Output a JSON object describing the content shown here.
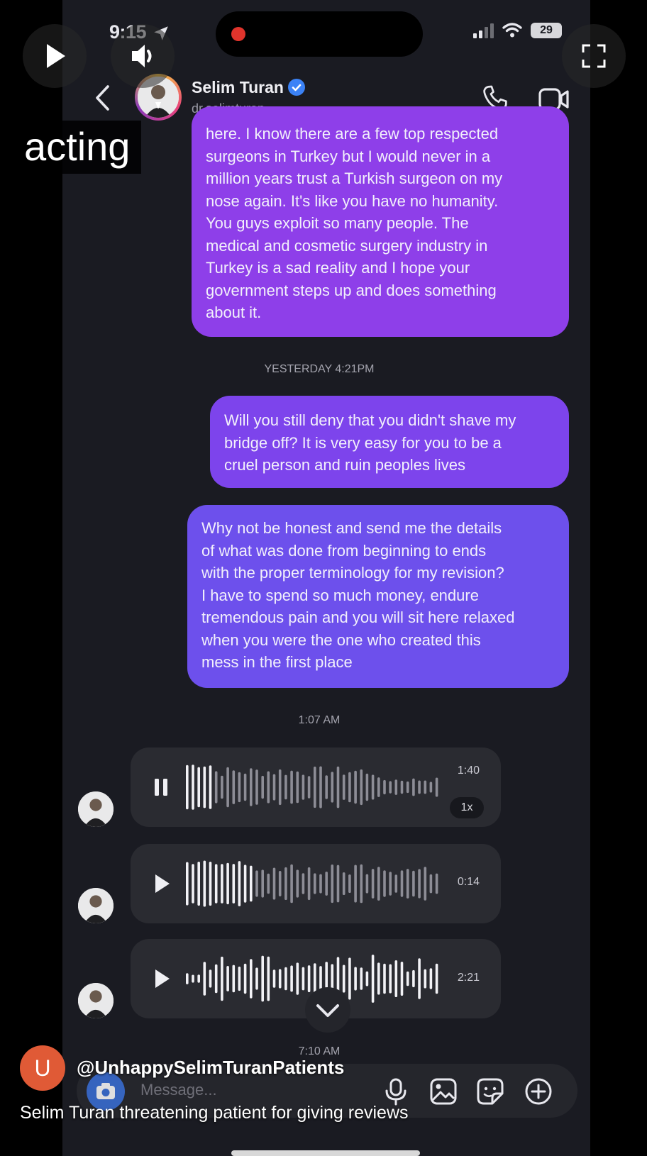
{
  "status_bar": {
    "time": "9:15",
    "battery": "29"
  },
  "header": {
    "name": "Selim Turan",
    "handle": "dr.selimturan"
  },
  "messages": [
    {
      "lines": [
        "here. I know there are a few top respected",
        "surgeons in Turkey but I would never in a",
        "million years trust a Turkish surgeon on my",
        "nose again. It's like you have no humanity.",
        "You guys exploit so many people. The",
        "medical and cosmetic surgery industry in",
        "Turkey is a sad reality and I hope your",
        "government steps up and does something",
        "about it."
      ]
    },
    {
      "lines": [
        "Will you still deny that you didn't shave my",
        "bridge off? It is very easy for you to be a",
        "cruel person and ruin peoples lives"
      ]
    },
    {
      "lines": [
        "Why not be honest and send me the details",
        "of what was done from beginning to ends",
        "with the proper terminology for my revision?",
        "I have to spend so much money, endure",
        "tremendous pain and you will sit here relaxed",
        "when you were the one who created this",
        "mess in the first place"
      ]
    }
  ],
  "timestamps": {
    "t1": "YESTERDAY 4:21PM",
    "t2": "1:07 AM",
    "t3": "7:10 AM"
  },
  "voice_notes": [
    {
      "duration": "1:40",
      "speed": "1x",
      "state": "pause-icon"
    },
    {
      "duration": "0:14",
      "state": "play-icon"
    },
    {
      "duration": "2:21",
      "state": "play-icon"
    }
  ],
  "composer": {
    "placeholder": "Message..."
  },
  "overlay": {
    "label": "acting",
    "channel": "@UnhappySelimTuranPatients",
    "channel_initial": "U",
    "title": "Selim Turan threatening patient for giving reviews"
  },
  "colors": {
    "bubble_top": "#8e3fe9",
    "bubble_mid": "#7d44ec",
    "bubble_bottom": "#6d50ec",
    "background": "#1a1b22",
    "verified": "#3b82f6",
    "avatar_orange": "#e05a36"
  }
}
